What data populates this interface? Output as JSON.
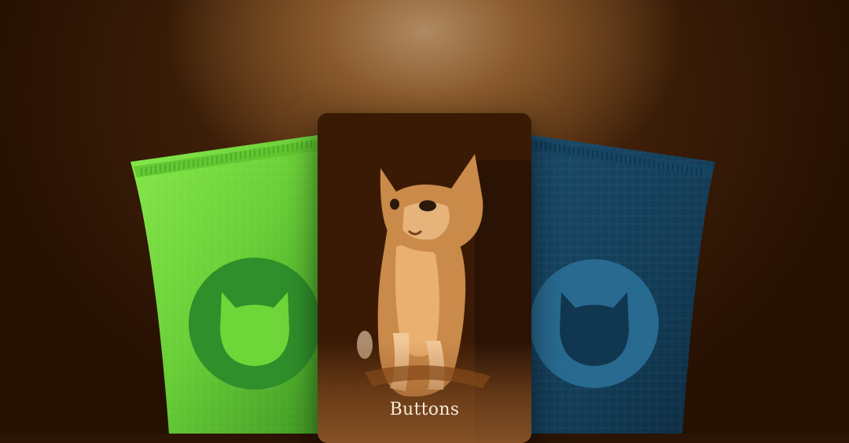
{
  "card": {
    "label": "Buttons"
  },
  "pouches": [
    {
      "name": "green-pouch",
      "color": "#6fd63a",
      "badge_color": "#2f8f2a"
    },
    {
      "name": "blue-pouch",
      "color": "#123b56",
      "badge_color": "#2a6f96"
    }
  ],
  "icons": [
    "cat-head-icon",
    "kitten-photo"
  ],
  "colors": {
    "background": "#2b1403",
    "label": "#f4ead8"
  }
}
